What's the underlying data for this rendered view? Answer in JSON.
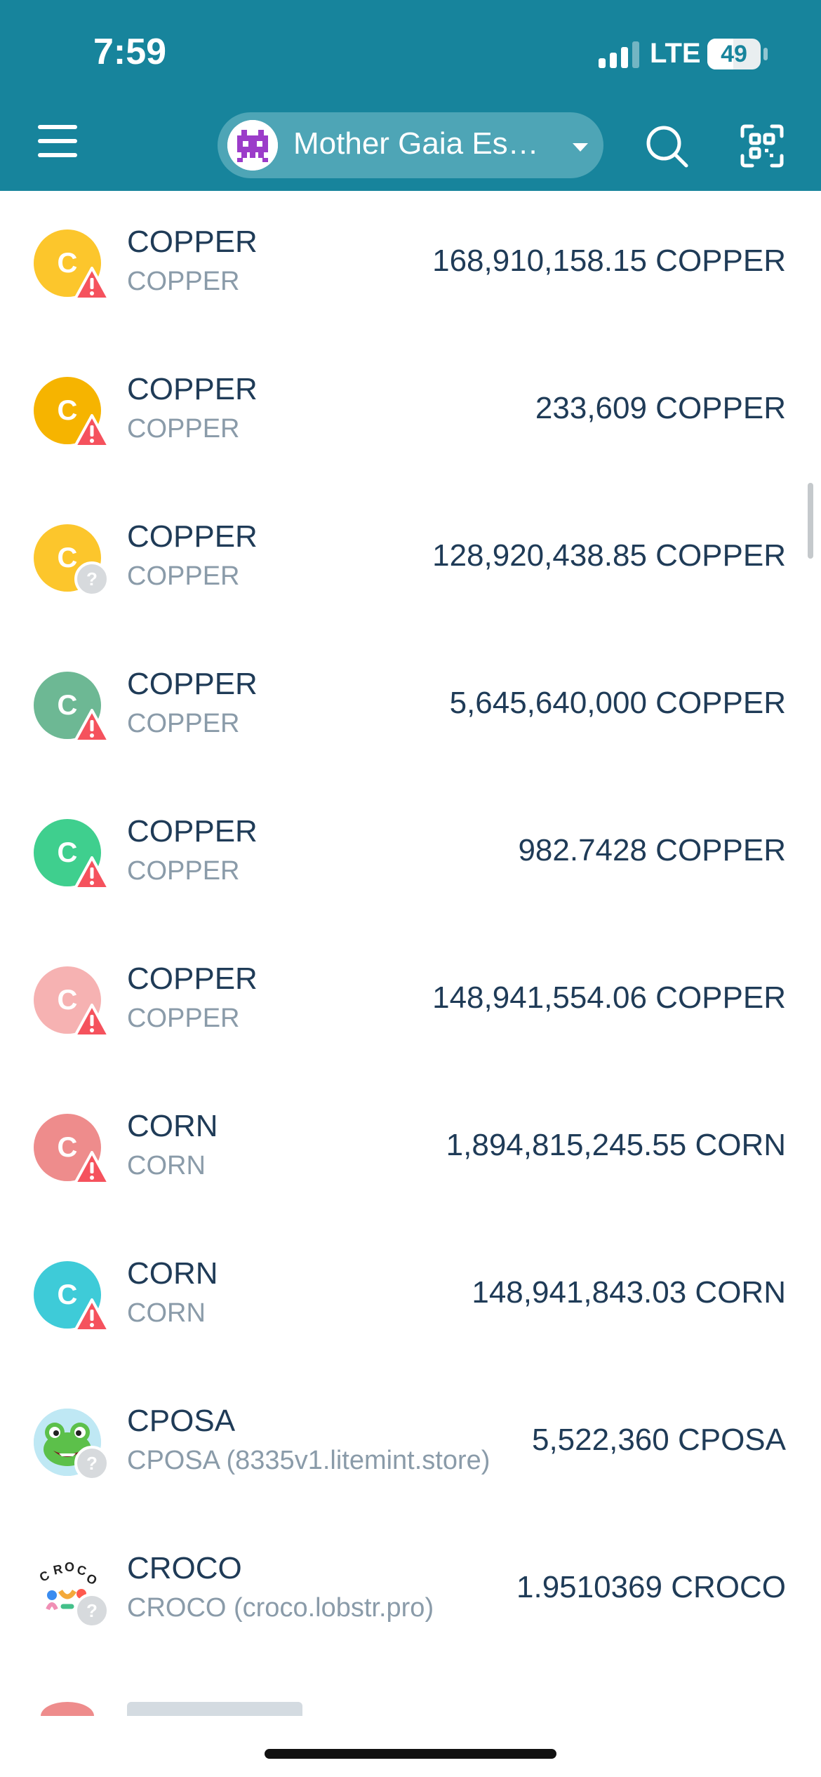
{
  "status_bar": {
    "time": "7:59",
    "network": "LTE",
    "battery": "49",
    "battery_level": 0.49
  },
  "header": {
    "account_name": "Mother Gaia Es…",
    "icons": [
      "menu-icon",
      "chevron-down-icon",
      "search-icon",
      "qr-scan-icon"
    ]
  },
  "assets": [
    {
      "name": "COPPER",
      "subtitle": "COPPER",
      "amount": "168,910,158.15 COPPER",
      "letter": "C",
      "color": "#fcc62c",
      "badge": "warning"
    },
    {
      "name": "COPPER",
      "subtitle": "COPPER",
      "amount": "233,609 COPPER",
      "letter": "C",
      "color": "#f6b400",
      "badge": "warning"
    },
    {
      "name": "COPPER",
      "subtitle": "COPPER",
      "amount": "128,920,438.85 COPPER",
      "letter": "C",
      "color": "#fcc62c",
      "badge": "unknown"
    },
    {
      "name": "COPPER",
      "subtitle": "COPPER",
      "amount": "5,645,640,000 COPPER",
      "letter": "C",
      "color": "#6db894",
      "badge": "warning"
    },
    {
      "name": "COPPER",
      "subtitle": "COPPER",
      "amount": "982.7428 COPPER",
      "letter": "C",
      "color": "#3fcf8e",
      "badge": "warning"
    },
    {
      "name": "COPPER",
      "subtitle": "COPPER",
      "amount": "148,941,554.06 COPPER",
      "letter": "C",
      "color": "#f6b2b2",
      "badge": "warning"
    },
    {
      "name": "CORN",
      "subtitle": "CORN",
      "amount": "1,894,815,245.55 CORN",
      "letter": "C",
      "color": "#ee8c8c",
      "badge": "warning"
    },
    {
      "name": "CORN",
      "subtitle": "CORN",
      "amount": "148,941,843.03 CORN",
      "letter": "C",
      "color": "#3ecbd8",
      "badge": "warning"
    },
    {
      "name": "CPOSA",
      "subtitle": "CPOSA (8335v1.litemint.store)",
      "amount": "5,522,360 CPOSA",
      "letter": "",
      "color": "#bfe8f4",
      "badge": "unknown",
      "logo": "frog-icon"
    },
    {
      "name": "CROCO",
      "subtitle": "CROCO (croco.lobstr.pro)",
      "amount": "1.9510369 CROCO",
      "letter": "",
      "color": "#ffffff",
      "badge": "unknown",
      "logo": "croco-logo-icon"
    }
  ],
  "colors": {
    "header": "#17849c",
    "pill": "#4ea5b6",
    "warning": "#f5525d",
    "unknown": "#d7dadd",
    "text": "#1f3b57",
    "subtext": "#8a9ba9"
  }
}
